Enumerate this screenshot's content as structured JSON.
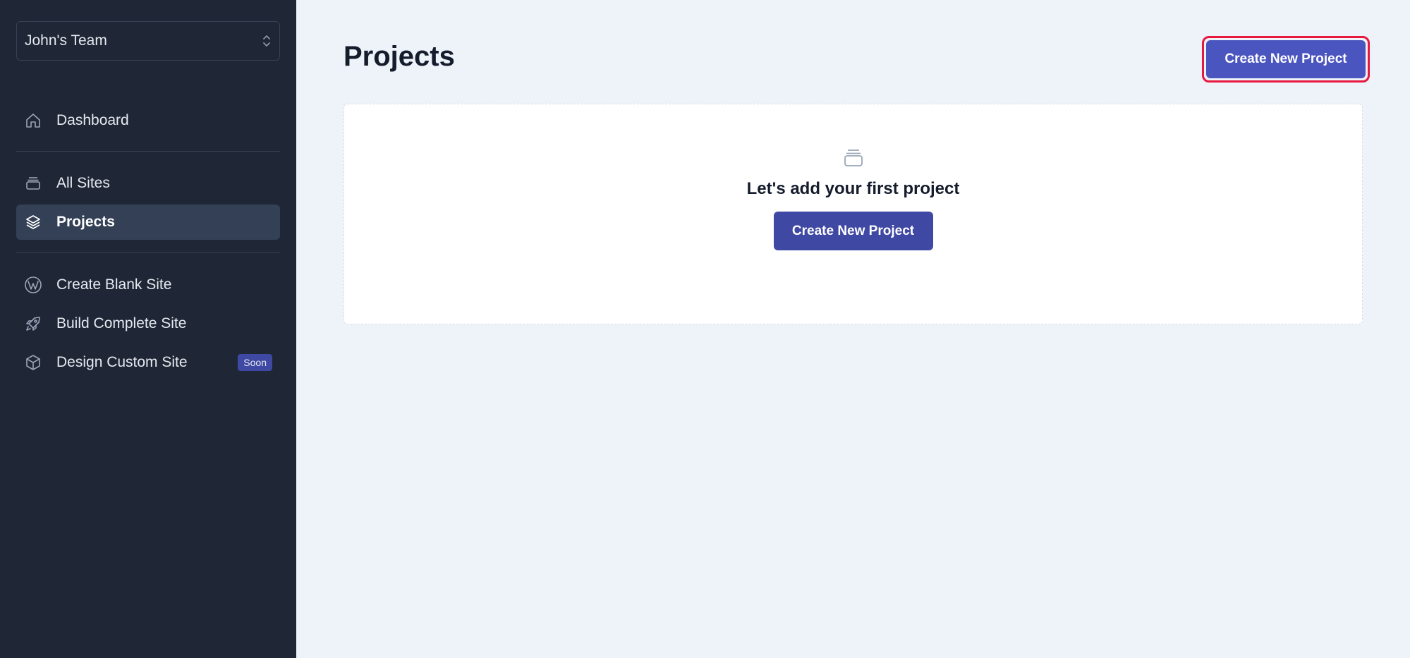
{
  "sidebar": {
    "team_name": "John's Team",
    "groups": [
      [
        {
          "label": "Dashboard",
          "icon": "home-icon",
          "active": false
        }
      ],
      [
        {
          "label": "All Sites",
          "icon": "stack-box-icon",
          "active": false
        },
        {
          "label": "Projects",
          "icon": "layers-icon",
          "active": true
        }
      ],
      [
        {
          "label": "Create Blank Site",
          "icon": "wordpress-icon",
          "active": false
        },
        {
          "label": "Build Complete Site",
          "icon": "rocket-icon",
          "active": false
        },
        {
          "label": "Design Custom Site",
          "icon": "cube-icon",
          "active": false,
          "badge": "Soon"
        }
      ]
    ]
  },
  "main": {
    "title": "Projects",
    "create_button_label": "Create New Project",
    "empty_state": {
      "icon": "stack-box-icon",
      "message": "Let's add your first project",
      "button_label": "Create New Project"
    }
  },
  "colors": {
    "sidebar_bg": "#1f2736",
    "active_item_bg": "#334056",
    "main_bg": "#eef2f9",
    "primary": "#3f48a3",
    "highlight_border": "#e8173e"
  }
}
